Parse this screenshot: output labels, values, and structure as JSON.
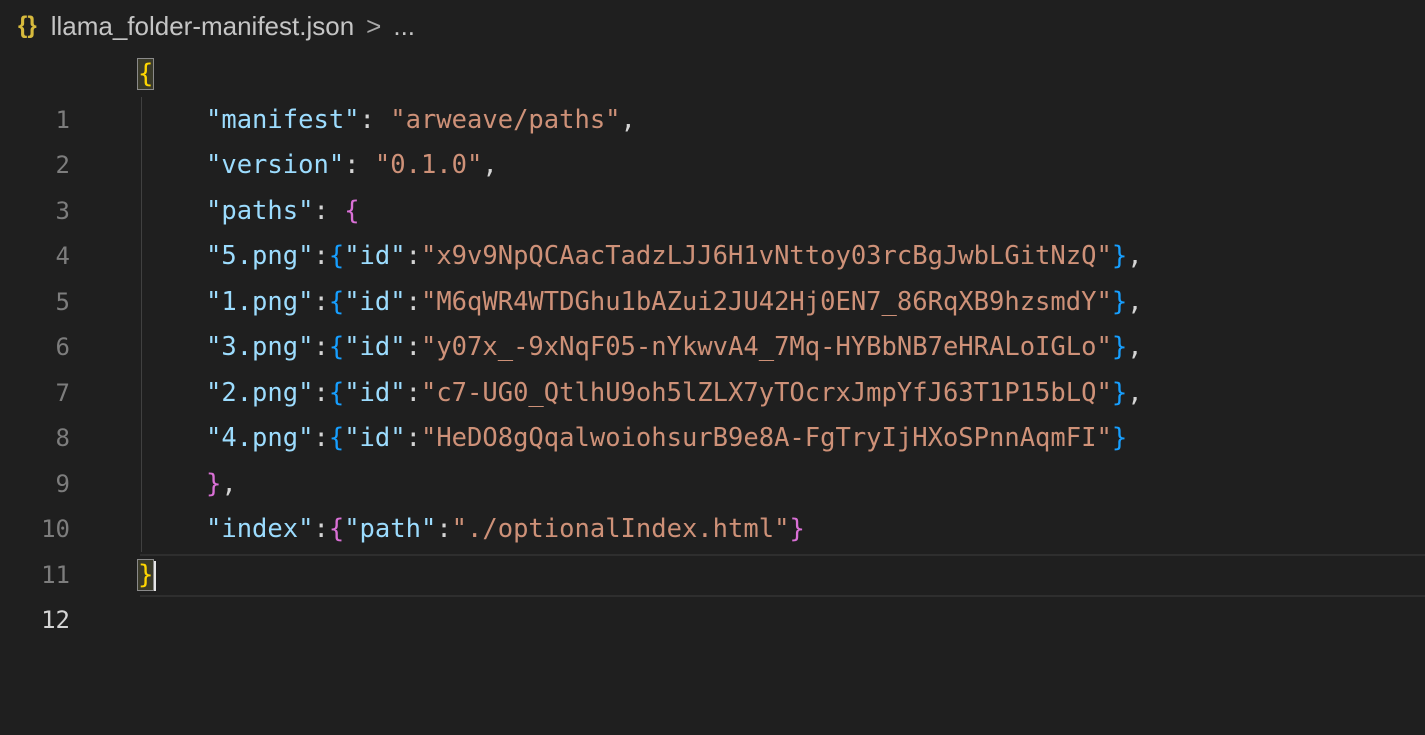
{
  "breadcrumb": {
    "icon": "{}",
    "file": "llama_folder-manifest.json",
    "separator": ">",
    "more": "..."
  },
  "line_numbers": [
    "1",
    "2",
    "3",
    "4",
    "5",
    "6",
    "7",
    "8",
    "9",
    "10",
    "11",
    "12"
  ],
  "tokens": {
    "open_brace": "{",
    "close_brace": "}",
    "colon": ":",
    "colon_space": ": ",
    "comma": ",",
    "quote_open": "\"",
    "k_manifest": "\"manifest\"",
    "v_manifest": "\"arweave/paths\"",
    "k_version": "\"version\"",
    "v_version": "\"0.1.0\"",
    "k_paths": "\"paths\"",
    "k_id": "\"id\"",
    "paths": [
      {
        "key": "\"5.png\"",
        "id": "\"x9v9NpQCAacTadzLJJ6H1vNttoy03rcBgJwbLGitNzQ\""
      },
      {
        "key": "\"1.png\"",
        "id": "\"M6qWR4WTDGhu1bAZui2JU42Hj0EN7_86RqXB9hzsmdY\""
      },
      {
        "key": "\"3.png\"",
        "id": "\"y07x_-9xNqF05-nYkwvA4_7Mq-HYBbNB7eHRALoIGLo\""
      },
      {
        "key": "\"2.png\"",
        "id": "\"c7-UG0_QtlhU9oh5lZLX7yTOcrxJmpYfJ63T1P15bLQ\""
      },
      {
        "key": "\"4.png\"",
        "id": "\"HeDO8gQqalwoiohsurB9e8A-FgTryIjHXoSPnnAqmFI\""
      }
    ],
    "paths_close": "},",
    "k_index": "\"index\"",
    "k_path": "\"path\"",
    "v_index_path": "\"./optionalIndex.html\""
  },
  "colors": {
    "background": "#1f1f1f",
    "json_key": "#9cdcfe",
    "json_string": "#ce9178",
    "bracket_level1": "#ffd700",
    "bracket_level2": "#da70d6",
    "bracket_level3": "#179fff"
  }
}
